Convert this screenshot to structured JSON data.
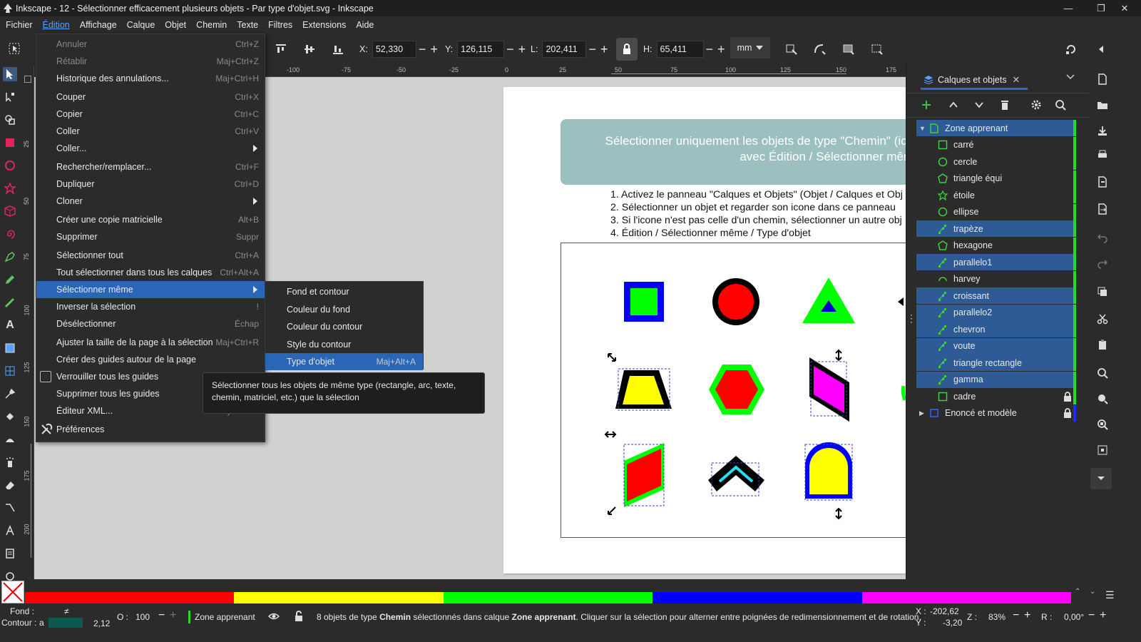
{
  "window": {
    "title": "Inkscape - 12 - Sélectionner efficacement plusieurs objets - Par type d'objet.svg - Inkscape"
  },
  "menubar": [
    "Fichier",
    "Édition",
    "Affichage",
    "Calque",
    "Objet",
    "Chemin",
    "Texte",
    "Filtres",
    "Extensions",
    "Aide"
  ],
  "toolbar": {
    "x_label": "X:",
    "x_value": "52,330",
    "y_label": "Y:",
    "y_value": "126,115",
    "w_label": "L:",
    "w_value": "202,411",
    "h_label": "H:",
    "h_value": "65,411",
    "unit": "mm"
  },
  "ruler": [
    "-100",
    "-75",
    "-50",
    "-25",
    "0",
    "25",
    "50",
    "75",
    "100",
    "125",
    "150",
    "175"
  ],
  "vruler": [
    "25",
    "50",
    "75",
    "100",
    "125",
    "150",
    "175",
    "200"
  ],
  "edit_menu": [
    {
      "label": "Annuler",
      "shortcut": "Ctrl+Z",
      "disabled": true
    },
    {
      "label": "Rétablir",
      "shortcut": "Maj+Ctrl+Z",
      "disabled": true
    },
    {
      "label": "Historique des annulations...",
      "shortcut": "Maj+Ctrl+H"
    },
    {
      "label": "Couper",
      "shortcut": "Ctrl+X"
    },
    {
      "label": "Copier",
      "shortcut": "Ctrl+C"
    },
    {
      "label": "Coller",
      "shortcut": "Ctrl+V"
    },
    {
      "label": "Coller...",
      "shortcut": "",
      "submenu": true
    },
    {
      "label": "Rechercher/remplacer...",
      "shortcut": "Ctrl+F"
    },
    {
      "label": "Dupliquer",
      "shortcut": "Ctrl+D"
    },
    {
      "label": "Cloner",
      "shortcut": "",
      "submenu": true
    },
    {
      "label": "Créer une copie matricielle",
      "shortcut": "Alt+B"
    },
    {
      "label": "Supprimer",
      "shortcut": "Suppr"
    },
    {
      "label": "Sélectionner tout",
      "shortcut": "Ctrl+A"
    },
    {
      "label": "Tout sélectionner dans tous les calques",
      "shortcut": "Ctrl+Alt+A"
    },
    {
      "label": "Sélectionner même",
      "shortcut": "",
      "submenu": true,
      "highlighted": true
    },
    {
      "label": "Inverser la sélection",
      "shortcut": "!"
    },
    {
      "label": "Désélectionner",
      "shortcut": "Échap"
    },
    {
      "label": "Ajuster la taille de la page à la sélection",
      "shortcut": "Maj+Ctrl+R"
    },
    {
      "label": "Créer des guides autour de la page",
      "shortcut": ""
    },
    {
      "label": "Verrouiller tous les guides",
      "shortcut": "",
      "checkbox": true
    },
    {
      "label": "Supprimer tous les guides",
      "shortcut": ""
    },
    {
      "label": "Éditeur XML...",
      "shortcut": "Maj+Ctrl+X"
    },
    {
      "label": "Préférences",
      "shortcut": "",
      "icon": true
    }
  ],
  "select_same_menu": [
    {
      "label": "Fond et contour",
      "shortcut": ""
    },
    {
      "label": "Couleur du fond",
      "shortcut": ""
    },
    {
      "label": "Couleur du contour",
      "shortcut": ""
    },
    {
      "label": "Style du contour",
      "shortcut": ""
    },
    {
      "label": "Type d'objet",
      "shortcut": "Maj+Alt+A",
      "highlighted": true
    }
  ],
  "tooltip": "Sélectionner tous les objets de même type (rectangle, arc, texte, chemin, matriciel, etc.) que la sélection",
  "canvas": {
    "banner_line1": "Sélectionner uniquement les objets de type \"Chemin\" (icône",
    "banner_line2": "avec Édition / Sélectionner même /",
    "instructions": [
      "1. Activez le panneau \"Calques et Objets\" (Objet / Calques et Obj",
      "2. Sélectionner un objet et regarder son icone dans ce panneau",
      "3. Si l'icone n'est pas celle d'un chemin, sélectionner un autre obj",
      "4. Édition / Sélectionner même / Type d'objet"
    ]
  },
  "panel": {
    "tab_title": "Calques et objets",
    "layers": [
      {
        "name": "Zone apprenant",
        "type": "layer",
        "level": 0,
        "selected": true
      },
      {
        "name": "carré",
        "type": "rect",
        "level": 1
      },
      {
        "name": "cercle",
        "type": "circle",
        "level": 1
      },
      {
        "name": "triangle équi",
        "type": "polygon",
        "level": 1
      },
      {
        "name": "étoile",
        "type": "star",
        "level": 1
      },
      {
        "name": "ellipse",
        "type": "circle",
        "level": 1
      },
      {
        "name": "trapèze",
        "type": "path",
        "level": 1,
        "selected": true
      },
      {
        "name": "hexagone",
        "type": "polygon",
        "level": 1
      },
      {
        "name": "parallelo1",
        "type": "path",
        "level": 1,
        "selected": true
      },
      {
        "name": "harvey",
        "type": "arc",
        "level": 1
      },
      {
        "name": "croissant",
        "type": "path",
        "level": 1,
        "selected": true
      },
      {
        "name": "parallelo2",
        "type": "path",
        "level": 1,
        "selected": true
      },
      {
        "name": "chevron",
        "type": "path",
        "level": 1,
        "selected": true
      },
      {
        "name": "voute",
        "type": "path",
        "level": 1,
        "selected": true
      },
      {
        "name": "triangle rectangle",
        "type": "path",
        "level": 1,
        "selected": true
      },
      {
        "name": "gamma",
        "type": "path",
        "level": 1,
        "selected": true
      },
      {
        "name": "cadre",
        "type": "rect",
        "level": 1,
        "locked": true
      },
      {
        "name": "Enoncé et modèle",
        "type": "layer-blue",
        "level": 0,
        "locked": true
      }
    ]
  },
  "palette": [
    "#ff0000",
    "#ffff00",
    "#00ff00",
    "#0000ff",
    "#ff00ff"
  ],
  "status": {
    "fill_label": "Fond :",
    "fill_value": "≠",
    "stroke_label": "Contour :",
    "stroke_value": "a",
    "stroke_width": "2,12",
    "opacity_label": "O :",
    "opacity_value": "100",
    "layer": "Zone apprenant",
    "message_pre": "8 objets de type ",
    "message_bold1": "Chemin",
    "message_mid": " sélectionnés dans calque ",
    "message_bold2": "Zone apprenant",
    "message_post": ". Cliquer sur la sélection pour alterner entre poignées de redimensionnement et de rotation.",
    "x_label": "X :",
    "x": "-202,62",
    "y_label": "Y :",
    "y": "-3,20",
    "zoom_label": "Z :",
    "zoom": "83%",
    "rot_label": "R :",
    "rotation": "0,00°"
  }
}
